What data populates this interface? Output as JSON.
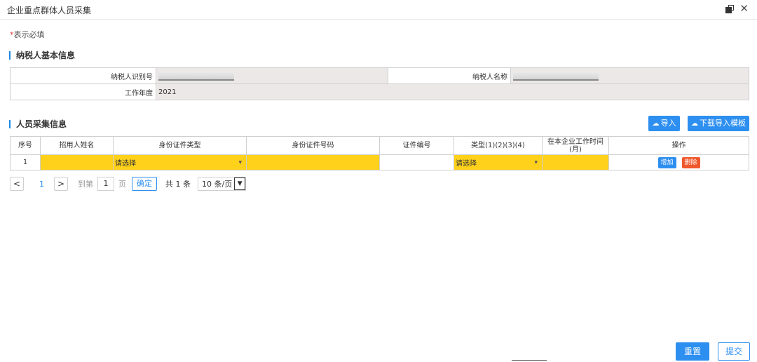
{
  "window": {
    "title": "企业重点群体人员采集"
  },
  "required_note": {
    "star": "*",
    "text": "表示必填"
  },
  "basic_section": {
    "title": "纳税人基本信息",
    "taxpayer_id_label": "纳税人识别号",
    "taxpayer_name_label": "纳税人名称",
    "work_year_label": "工作年度",
    "work_year_value": "2021"
  },
  "people_section": {
    "title": "人员采集信息",
    "import_label": "导入",
    "download_template_label": "下载导入模板",
    "columns": [
      "序号",
      "招用人姓名",
      "身份证件类型",
      "身份证件号码",
      "证件编号",
      "类型(1)(2)(3)(4)",
      "在本企业工作时间(月)",
      "操作"
    ],
    "rows": [
      {
        "index": "1",
        "name": "",
        "id_type": "请选择",
        "id_number": "",
        "cert_number": "",
        "category": "请选择",
        "months": ""
      }
    ],
    "add_label": "增加",
    "delete_label": "删除"
  },
  "pagination": {
    "prev": "<",
    "current_page": "1",
    "next": ">",
    "goto_label": "到第",
    "goto_value": "1",
    "page_unit": "页",
    "confirm_label": "确定",
    "total_text": "共 1 条",
    "page_size": "10 条/页"
  },
  "footer": {
    "reset_label": "重置",
    "submit_label": "提交"
  },
  "colors": {
    "accent": "#2d8ff0",
    "required_fill": "#ffd11a",
    "danger": "#f0582d",
    "readonly_fill": "#ece8e8"
  }
}
